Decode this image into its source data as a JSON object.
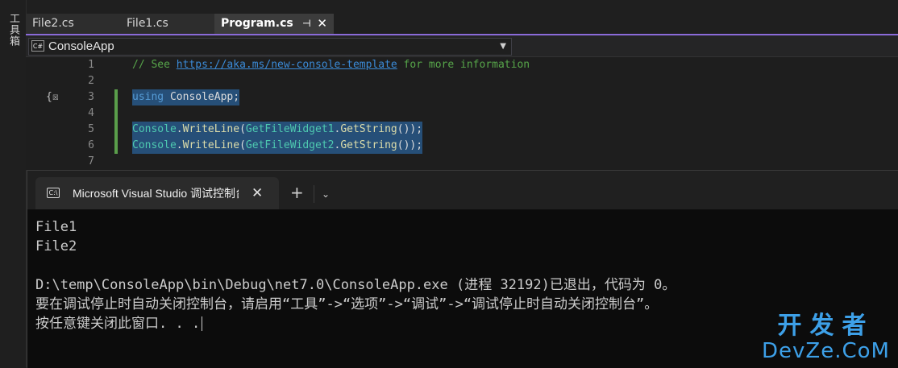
{
  "toolbox": {
    "label": "工具箱"
  },
  "tabs": [
    {
      "label": "File2.cs"
    },
    {
      "label": "File1.cs"
    },
    {
      "label": "Program.cs",
      "pin": "⊣",
      "close": "✕"
    }
  ],
  "navbar": {
    "project": "ConsoleApp",
    "icon_text": "C#"
  },
  "editor": {
    "lines": [
      {
        "num": "1",
        "comment_prefix": "// See ",
        "link": "https://aka.ms/new-console-template",
        "comment_suffix": " for more information"
      },
      {
        "num": "2"
      },
      {
        "num": "3",
        "kw": "using",
        "rest": " ConsoleApp;"
      },
      {
        "num": "4"
      },
      {
        "num": "5",
        "type": "Console",
        "dot": ".",
        "method": "WriteLine",
        "open": "(",
        "arg_type": "GetFileWidget1",
        "arg_dot": ".",
        "arg_method": "GetString",
        "close": "());"
      },
      {
        "num": "6",
        "type": "Console",
        "dot": ".",
        "method": "WriteLine",
        "open": "(",
        "arg_type": "GetFileWidget2",
        "arg_dot": ".",
        "arg_method": "GetString",
        "close": "());"
      },
      {
        "num": "7"
      }
    ]
  },
  "terminal": {
    "tab_title": "Microsoft Visual Studio 调试控制台",
    "icon_text": "C:\\",
    "add": "+",
    "dropdown": "⌄",
    "output": [
      "File1",
      "File2",
      "",
      "D:\\temp\\ConsoleApp\\bin\\Debug\\net7.0\\ConsoleApp.exe (进程 32192)已退出，代码为 0。",
      "要在调试停止时自动关闭控制台，请启用“工具”->“选项”->“调试”->“调试停止时自动关闭控制台”。",
      "按任意键关闭此窗口. . ."
    ]
  },
  "watermark": {
    "top": "开发者",
    "bottom": "DevZe.CoM"
  },
  "colors": {
    "accent": "#8a6ad8",
    "change_bar": "#5a9e4b",
    "watermark": "#3da0e8"
  }
}
